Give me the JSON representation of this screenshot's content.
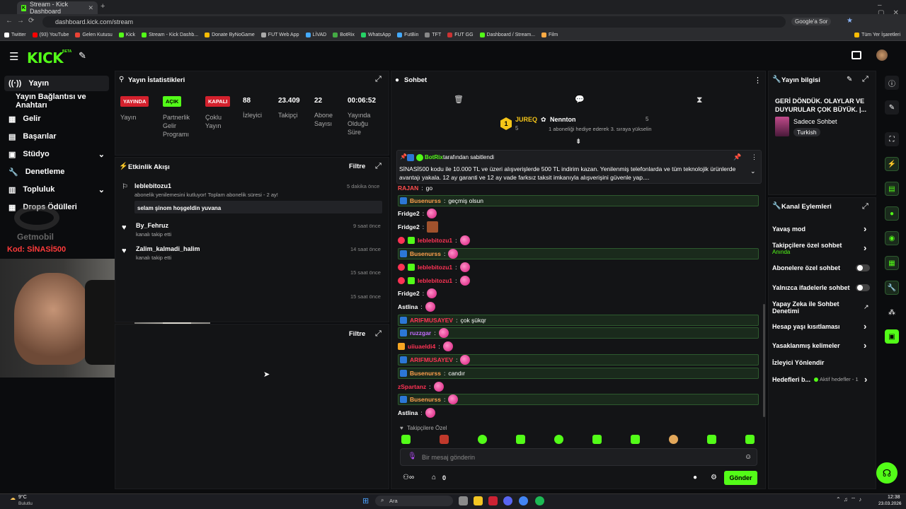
{
  "browser": {
    "tab_title": "Stream - Kick Dashboard",
    "url": "dashboard.kick.com/stream",
    "google_lens": "Google'a Sor",
    "bookmarks": [
      "Twitter",
      "(93) YouTube",
      "Gelen Kutusu",
      "Kick",
      "Stream - Kick Dashb...",
      "Donate ByNoGame",
      "FUT Web App",
      "LİVAD",
      "BotRix",
      "WhatsApp",
      "FutBin",
      "TFT",
      "FUT GG",
      "Dashboard / Stream...",
      "Film"
    ],
    "all_bookmarks": "Tüm Yer İşaretleri"
  },
  "app": {
    "logo": "KICK",
    "logo_beta": "BETA"
  },
  "sidebar": {
    "items": [
      {
        "label": "Yayın"
      },
      {
        "label": "Yayın Bağlantısı ve Anahtarı"
      },
      {
        "label": "Gelir"
      },
      {
        "label": "Başarılar"
      },
      {
        "label": "Stüdyo"
      },
      {
        "label": "Denetleme"
      },
      {
        "label": "Topluluk"
      },
      {
        "label": "Drops Ödülleri"
      }
    ],
    "overlay_brand": "Getmobil",
    "overlay_code": "Kod: SİNASİ500"
  },
  "stats": {
    "title": "Yayın İstatistikleri",
    "items": [
      {
        "badge": "YAYINDA",
        "label": "Yayın",
        "color": "#d3212d"
      },
      {
        "badge": "AÇIK",
        "label": "Partnerlik Gelir Programı",
        "color": "#53fc18"
      },
      {
        "badge": "KAPALI",
        "label": "Çoklu Yayın",
        "color": "#d3212d"
      },
      {
        "value": "88",
        "label": "İzleyici"
      },
      {
        "value": "23.409",
        "label": "Takipçi"
      },
      {
        "value": "22",
        "label": "Abone Sayısı"
      },
      {
        "value": "00:06:52",
        "label": "Yayında Olduğu Süre"
      }
    ]
  },
  "activity": {
    "title": "Etkinlik Akışı",
    "filter": "Filtre",
    "events": [
      {
        "name": "leblebitozu1",
        "sub": "abonelik yenilemesini kutluyor! Toplam abonelik süresi - 2 ay!",
        "time": "5 dakika önce",
        "msg": "selam şinom hoşgeldin yuvana"
      },
      {
        "name": "By_Fehruz",
        "sub": "kanalı takip etti",
        "time": "9 saat önce"
      },
      {
        "name": "Zalim_kalmadi_halim",
        "sub": "kanalı takip etti",
        "time": "14 saat önce"
      },
      {
        "time": "15 saat önce"
      },
      {
        "time": "15 saat önce"
      }
    ],
    "filter2": "Filtre"
  },
  "chat": {
    "title": "Sohbet",
    "top_gifter": {
      "name": "JUREQ",
      "rank": "1",
      "count": "5"
    },
    "gift_user": {
      "name": "Nennton",
      "count": "5",
      "note": "1 aboneliği hediye ederek 3. sıraya yükselin"
    },
    "pinned_by": "BotRix",
    "pinned_label": "tarafından sabitlendi",
    "pinned_text": "SİNASİ500 kodu ile 10.000 TL ve üzeri alışverişlerde 500 TL indirim kazan.  Yenilenmiş telefonlarda ve tüm teknolojik ürünlerde avantajı yakala. 12 ay garanti ve 12 ay vade farksız taksit imkanıyla alışverişini güvenle yap....",
    "messages": [
      {
        "user": "RAJAN",
        "text": "go",
        "color": "#ff4d4d"
      },
      {
        "user": "Busenurss",
        "text": "geçmiş olsun",
        "color": "#ffa04d",
        "hl": true
      },
      {
        "user": "Fridge2",
        "text": "",
        "color": "#ffffff"
      },
      {
        "user": "Fridge2",
        "text": "",
        "color": "#ffffff"
      },
      {
        "user": "leblebitozu1",
        "text": "",
        "color": "#ff3355"
      },
      {
        "user": "Busenurss",
        "text": "",
        "color": "#ffa04d",
        "hl": true
      },
      {
        "user": "leblebitozu1",
        "text": "",
        "color": "#ff3355"
      },
      {
        "user": "leblebitozu1",
        "text": "",
        "color": "#ff3355"
      },
      {
        "user": "Fridge2",
        "text": "",
        "color": "#ffffff"
      },
      {
        "user": "Astlina",
        "text": "",
        "color": "#ffffff"
      },
      {
        "user": "ARIFMUSAYEV",
        "text": "çok şükqr",
        "color": "#ff3355",
        "hl": true
      },
      {
        "user": "ruzzgar",
        "text": "",
        "color": "#c36bff",
        "hl": true
      },
      {
        "user": "uiiuaeldi4",
        "text": "",
        "color": "#ff3355"
      },
      {
        "user": "ARIFMUSAYEV",
        "text": "",
        "color": "#ff3355",
        "hl": true
      },
      {
        "user": "Busenurss",
        "text": "candır",
        "color": "#ffa04d",
        "hl": true
      },
      {
        "user": "zSpartanz",
        "text": "",
        "color": "#ff3355"
      },
      {
        "user": "Busenurss",
        "text": "",
        "color": "#ffa04d",
        "hl": true
      },
      {
        "user": "Astlina",
        "text": "",
        "color": "#ffffff"
      }
    ],
    "followers_only": "Takipçilere Özel",
    "input_placeholder": "Bir mesaj gönderin",
    "send": "Gönder",
    "points": "0"
  },
  "stream_info": {
    "title": "Yayın bilgisi",
    "stream_title": "GERİ DÖNDÜK. OLAYLAR VE DUYURULAR ÇOK BÜYÜK. |...",
    "category": "Sadece Sohbet",
    "language": "Turkish"
  },
  "channel_actions": {
    "title": "Kanal Eylemleri",
    "rows": [
      {
        "label": "Yavaş mod"
      },
      {
        "label": "Takipçilere özel sohbet",
        "sub": "Anında"
      },
      {
        "label": "Abonelere özel sohbet"
      },
      {
        "label": "Yalnızca ifadelerle sohbet"
      },
      {
        "label": "Yapay Zeka ile Sohbet Denetimi"
      },
      {
        "label": "Hesap yaşı kısıtlaması"
      },
      {
        "label": "Yasaklanmış kelimeler"
      },
      {
        "label": "İzleyici Yönlendir"
      },
      {
        "label": "Hedefleri b...",
        "sub": "Aktif hedefler - 1"
      }
    ]
  },
  "taskbar": {
    "weather_temp": "9°C",
    "weather_desc": "Bulutlu",
    "search": "Ara",
    "time": "12:38",
    "date": "23.03.2026"
  }
}
